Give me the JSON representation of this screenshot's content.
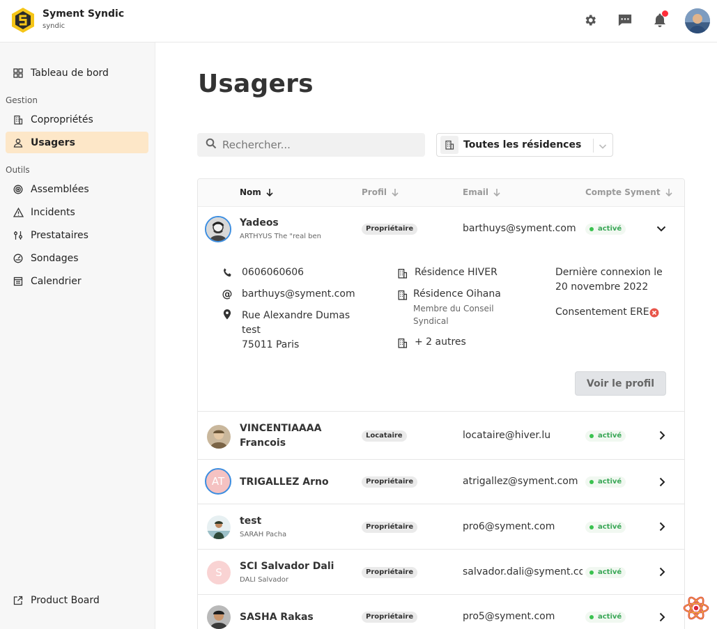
{
  "header": {
    "brand_title": "Syment Syndic",
    "brand_sub": "syndic",
    "icons": [
      "gear-icon",
      "chat-icon",
      "bell-icon"
    ],
    "has_notification": true
  },
  "sidebar": {
    "dashboard": "Tableau de bord",
    "section_gestion": "Gestion",
    "coproprietes": "Copropriétés",
    "usagers": "Usagers",
    "section_outils": "Outils",
    "assemblees": "Assemblées",
    "incidents": "Incidents",
    "prestataires": "Prestataires",
    "sondages": "Sondages",
    "calendrier": "Calendrier",
    "product_board": "Product Board",
    "active": "usagers"
  },
  "main": {
    "title": "Usagers",
    "search_placeholder": "Rechercher...",
    "residence_filter": "Toutes les résidences"
  },
  "table": {
    "columns": {
      "nom": "Nom",
      "profil": "Profil",
      "email": "Email",
      "compte": "Compte Syment"
    },
    "rows": [
      {
        "name": "Yadeos",
        "sub": "ARTHYUS The \"real ben",
        "profile": "Propriétaire",
        "email": "barthuys@syment.com",
        "status": "activé",
        "expanded": true
      },
      {
        "name": "VINCENTIAAAA Francois",
        "sub": "",
        "profile": "Locataire",
        "email": "locataire@hiver.lu",
        "status": "activé",
        "expanded": false
      },
      {
        "name": "TRIGALLEZ Arno",
        "sub": "",
        "initials": "AT",
        "profile": "Propriétaire",
        "email": "atrigallez@syment.com",
        "status": "activé",
        "expanded": false
      },
      {
        "name": "test",
        "sub": "SARAH Pacha",
        "profile": "Propriétaire",
        "email": "pro6@syment.com",
        "status": "activé",
        "expanded": false
      },
      {
        "name": "SCI Salvador Dali",
        "sub": "DALI Salvador",
        "initials": "S",
        "profile": "Propriétaire",
        "email": "salvador.dali@syment.co...",
        "status": "activé",
        "expanded": false
      },
      {
        "name": "SASHA Rakas",
        "sub": "",
        "profile": "Propriétaire",
        "email": "pro5@syment.com",
        "status": "activé",
        "expanded": false
      }
    ],
    "detail": {
      "phone": "0606060606",
      "email": "barthuys@syment.com",
      "address_line1": "Rue Alexandre Dumas",
      "address_line2": "test",
      "address_line3": "75011 Paris",
      "residence1": "Résidence HIVER",
      "residence2": "Résidence Oihana",
      "residence2_role_line1": "Membre du Conseil",
      "residence2_role_line2": "Syndical",
      "residence_more": "+ 2 autres",
      "last_login_line1": "Dernière connexion le",
      "last_login_line2": "20 novembre 2022",
      "consent": "Consentement ERE",
      "view_profile": "Voir le profil"
    }
  },
  "colors": {
    "accent_active_bg": "#fde7c8",
    "status_green": "#3aa757",
    "ring_blue": "#3b8de0",
    "logo_yellow": "#f5c518",
    "consent_red": "#e8554a"
  }
}
